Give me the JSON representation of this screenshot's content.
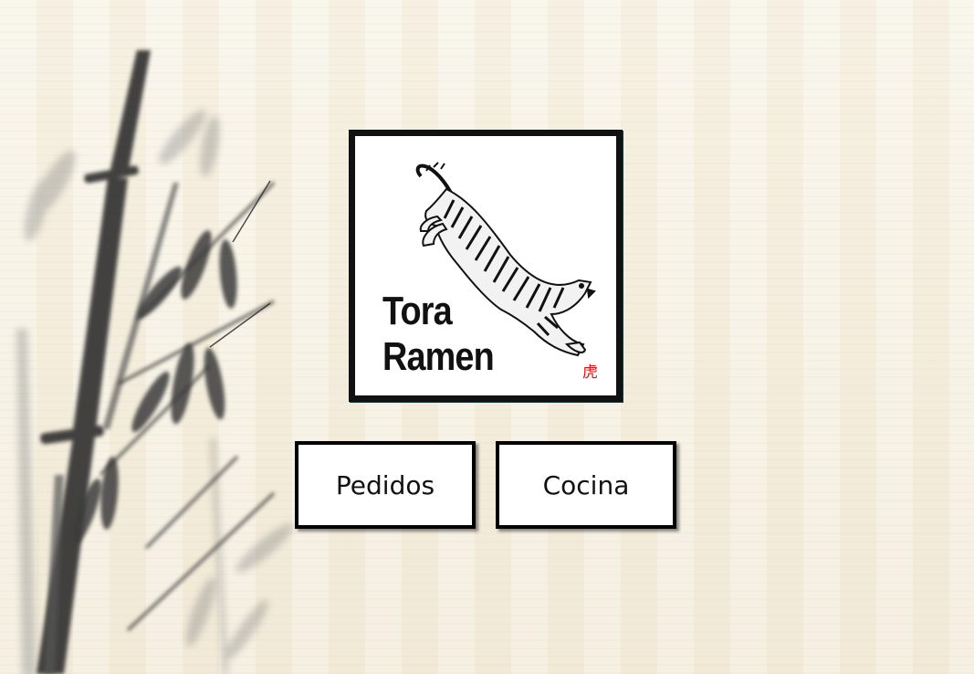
{
  "logo": {
    "line1": "Tora",
    "line2": "Ramen",
    "kanji": "虎"
  },
  "buttons": {
    "pedidos": "Pedidos",
    "cocina": "Cocina"
  },
  "colors": {
    "background": "#f6f1e3",
    "kanji": "#e01010",
    "border": "#000000"
  }
}
